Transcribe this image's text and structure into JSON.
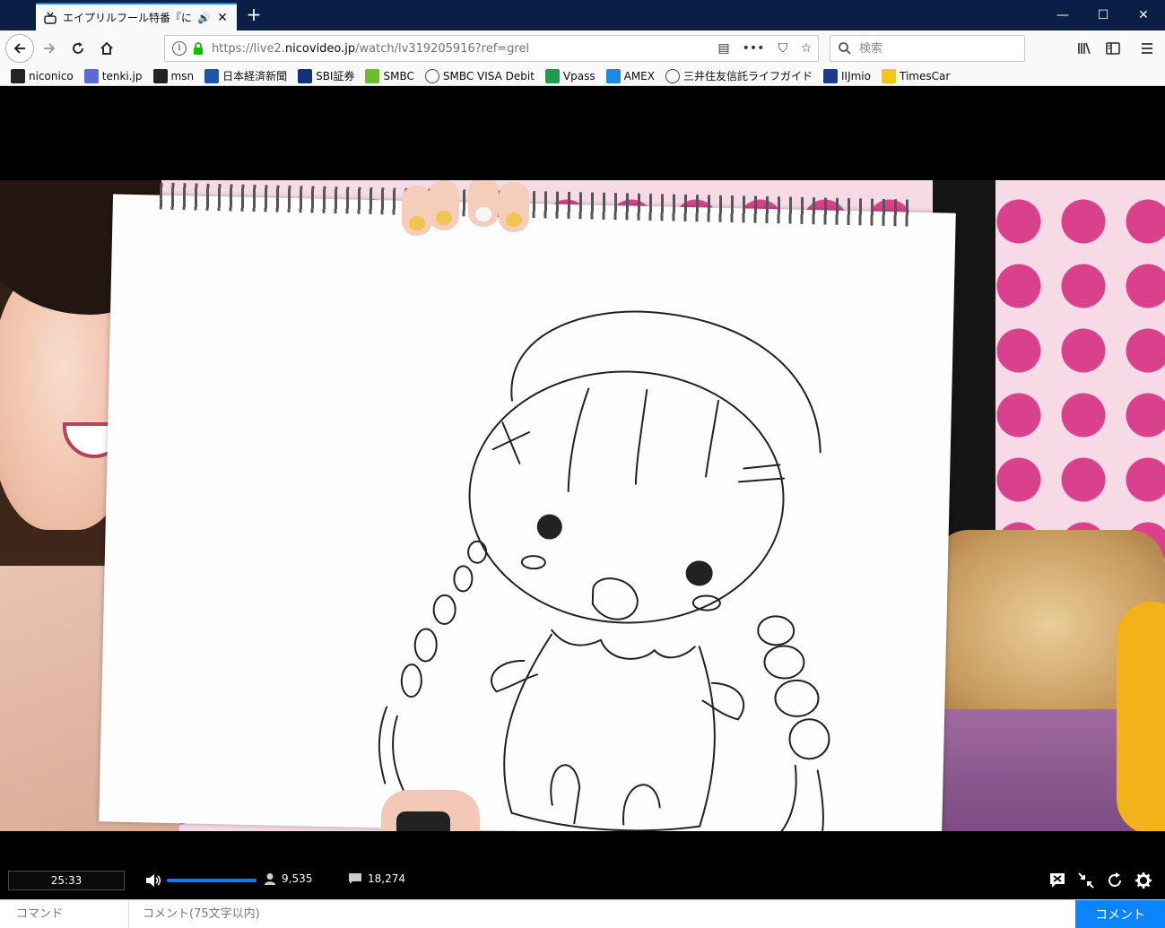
{
  "browser": {
    "tab": {
      "title": "エイプリルフール特番『にこにこみ",
      "favicon": "niconico-favicon-icon"
    },
    "window_buttons": [
      "minimize-icon",
      "maximize-icon",
      "close-icon"
    ],
    "url": {
      "prefix": "https://live2.",
      "domain": "nicovideo.jp",
      "path": "/watch/lv319205916?ref=grel"
    },
    "search": {
      "placeholder": "検索"
    },
    "accent_color": "#0a84ff",
    "titlebar_color": "#0a1f44"
  },
  "bookmarks": [
    {
      "label": "niconico",
      "icon": "niconico-icon",
      "color": "#222222"
    },
    {
      "label": "tenki.jp",
      "icon": "tenki-icon",
      "color": "#5a6bd8"
    },
    {
      "label": "msn",
      "icon": "msn-icon",
      "color": "#222222"
    },
    {
      "label": "日本経済新聞",
      "icon": "nikkei-icon",
      "color": "#1b56a8"
    },
    {
      "label": "SBI証券",
      "icon": "sbi-icon",
      "color": "#13307a"
    },
    {
      "label": "SMBC",
      "icon": "smbc-icon",
      "color": "#6cbc2e"
    },
    {
      "label": "SMBC VISA Debit",
      "icon": "globe-icon",
      "color": "#444444"
    },
    {
      "label": "Vpass",
      "icon": "vpass-icon",
      "color": "#1f9c4b"
    },
    {
      "label": "AMEX",
      "icon": "amex-icon",
      "color": "#1e88e5"
    },
    {
      "label": "三井住友信託ライフガイド",
      "icon": "globe-icon",
      "color": "#444444"
    },
    {
      "label": "IIJmio",
      "icon": "iijmio-icon",
      "color": "#1e3a8a"
    },
    {
      "label": "TimesCar",
      "icon": "timescar-icon",
      "color": "#f5c518"
    }
  ],
  "player": {
    "elapsed": "25:33",
    "volume_level": 1.0,
    "viewers": "9,535",
    "comments": "18,274",
    "progress_color": "#0080ff"
  },
  "comment_bar": {
    "command_placeholder": "コマンド",
    "comment_placeholder": "コメント(75文字以内)",
    "submit_label": "コメント"
  }
}
